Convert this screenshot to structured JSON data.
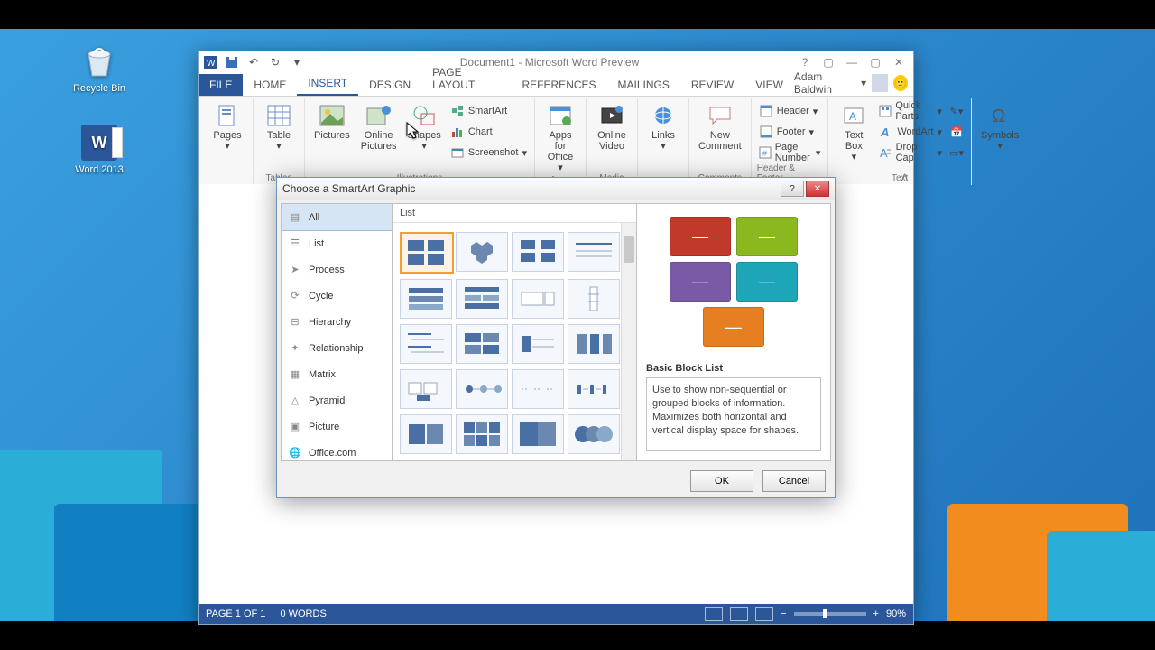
{
  "desktop": {
    "recycle_label": "Recycle Bin",
    "word_label": "Word 2013"
  },
  "window": {
    "title": "Document1 - Microsoft Word Preview",
    "user_name": "Adam Baldwin"
  },
  "tabs": {
    "file": "FILE",
    "home": "HOME",
    "insert": "INSERT",
    "design": "DESIGN",
    "page_layout": "PAGE LAYOUT",
    "references": "REFERENCES",
    "mailings": "MAILINGS",
    "review": "REVIEW",
    "view": "VIEW"
  },
  "ribbon": {
    "pages": "Pages",
    "table": "Table",
    "tables_group": "Tables",
    "pictures": "Pictures",
    "online_pictures": "Online\nPictures",
    "shapes": "Shapes",
    "smartart": "SmartArt",
    "chart": "Chart",
    "screenshot": "Screenshot",
    "illustrations_group": "Illustrations",
    "apps_for_office": "Apps for\nOffice",
    "apps_group": "Apps",
    "online_video": "Online\nVideo",
    "media_group": "Media",
    "links": "Links",
    "new_comment": "New\nComment",
    "comments_group": "Comments",
    "header": "Header",
    "footer": "Footer",
    "page_number": "Page Number",
    "hf_group": "Header & Footer",
    "text_box": "Text\nBox",
    "quick_parts": "Quick Parts",
    "wordart": "WordArt",
    "drop_cap": "Drop Cap",
    "text_group": "Text",
    "symbols": "Symbols"
  },
  "statusbar": {
    "page": "PAGE 1 OF 1",
    "words": "0 WORDS",
    "zoom": "90%"
  },
  "dialog": {
    "title": "Choose a SmartArt Graphic",
    "categories": [
      "All",
      "List",
      "Process",
      "Cycle",
      "Hierarchy",
      "Relationship",
      "Matrix",
      "Pyramid",
      "Picture",
      "Office.com"
    ],
    "selected_category": "All",
    "gallery_header": "List",
    "preview_name": "Basic Block List",
    "preview_desc": "Use to show non-sequential or grouped blocks of information. Maximizes both horizontal and vertical display space for shapes.",
    "preview_colors": [
      "#c0392b",
      "#8bb81e",
      "#7a5aa6",
      "#1fa5b8",
      "#e67e22"
    ],
    "ok": "OK",
    "cancel": "Cancel"
  }
}
